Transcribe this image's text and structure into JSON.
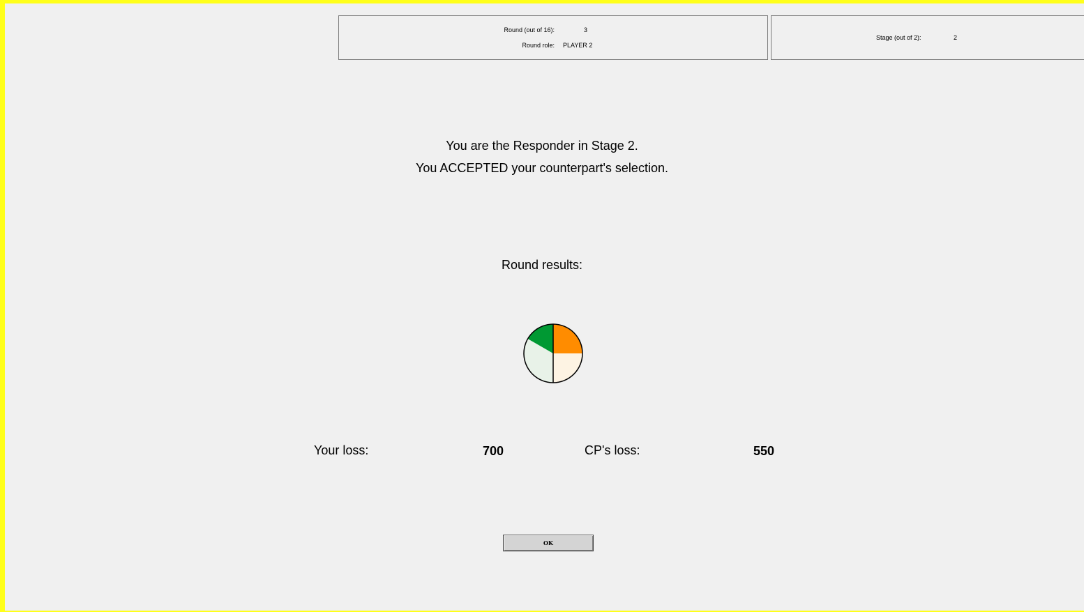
{
  "header": {
    "round_label": "Round (out of 16):",
    "round_value": "3",
    "role_label": "Round role:",
    "role_value": "PLAYER 2",
    "stage_label": "Stage (out of 2):",
    "stage_value": "2"
  },
  "message": {
    "line1": "You are the Responder in Stage 2.",
    "line2": "You ACCEPTED your counterpart's selection."
  },
  "results": {
    "heading": "Round results:",
    "your_loss_label": "Your loss:",
    "your_loss_value": "700",
    "cp_loss_label": "CP's loss:",
    "cp_loss_value": "550"
  },
  "pie_chart": {
    "segments": [
      {
        "name": "top-right",
        "color": "#ff8c00"
      },
      {
        "name": "bottom-right",
        "color": "#fdf3e3"
      },
      {
        "name": "bottom-left",
        "color": "#e8f2e8"
      },
      {
        "name": "top-left",
        "color": "#009933"
      }
    ]
  },
  "ok_button": {
    "label": "OK"
  }
}
